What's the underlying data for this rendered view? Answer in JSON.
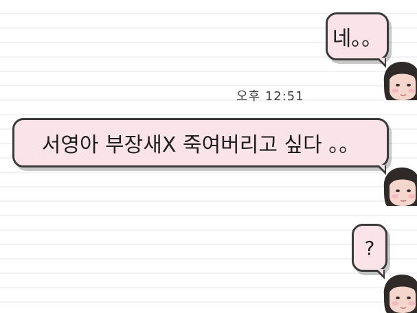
{
  "messages": [
    {
      "text": "네。。"
    },
    {
      "text": "서영아 부장새X 죽여버리고 싶다 。。"
    },
    {
      "text": "?"
    }
  ],
  "timestamp": "오후 12:51",
  "colors": {
    "bubble_fill": "#fbe3ea",
    "bubble_border": "#3a3a3a",
    "text": "#1e1e1e",
    "background": "#ffffff",
    "rule_line": "#f1f1f1"
  },
  "icons": {
    "avatar": "profile-avatar-icon"
  }
}
